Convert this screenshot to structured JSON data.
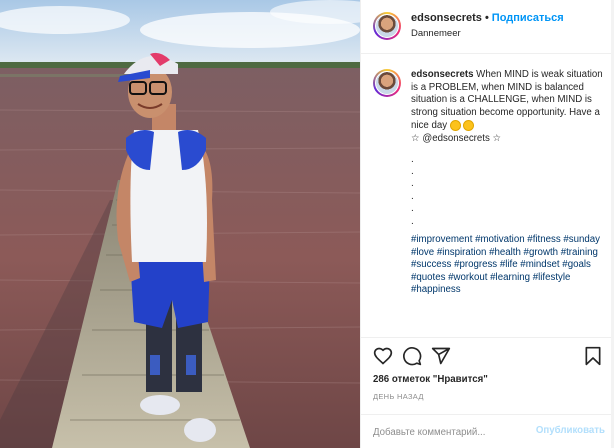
{
  "post": {
    "username": "edsonsecrets",
    "follow_label": "Подписаться",
    "location": "Dannemeer",
    "caption": {
      "username": "edsonsecrets",
      "text": "When MIND is weak situation is a PROBLEM, when MIND is balanced situation is a CHALLENGE, when MIND is strong situation become opportunity. Have a nice day",
      "mention_line": "☆ @edsonsecrets ☆",
      "dots": [
        ".",
        ".",
        ".",
        ".",
        ".",
        "."
      ],
      "hashtags": "#improvement #motivation #fitness #sunday #love #inspiration #health #growth #training #success #progress #life #mindset #goals #quotes #workout #learning #lifestyle #happiness"
    },
    "likes_text": "286 отметок \"Нравится\"",
    "time_ago": "ДЕНЬ НАЗАД",
    "comment_placeholder": "Добавьте комментарий...",
    "publish_label": "Опубликовать"
  },
  "icons": {
    "like": "heart-icon",
    "comment": "comment-icon",
    "share": "share-icon",
    "save": "bookmark-icon"
  },
  "colors": {
    "link_blue": "#0095f6",
    "hashtag_blue": "#00376b",
    "publish_disabled": "#b2dffc",
    "muted_text": "#8e8e8e"
  }
}
